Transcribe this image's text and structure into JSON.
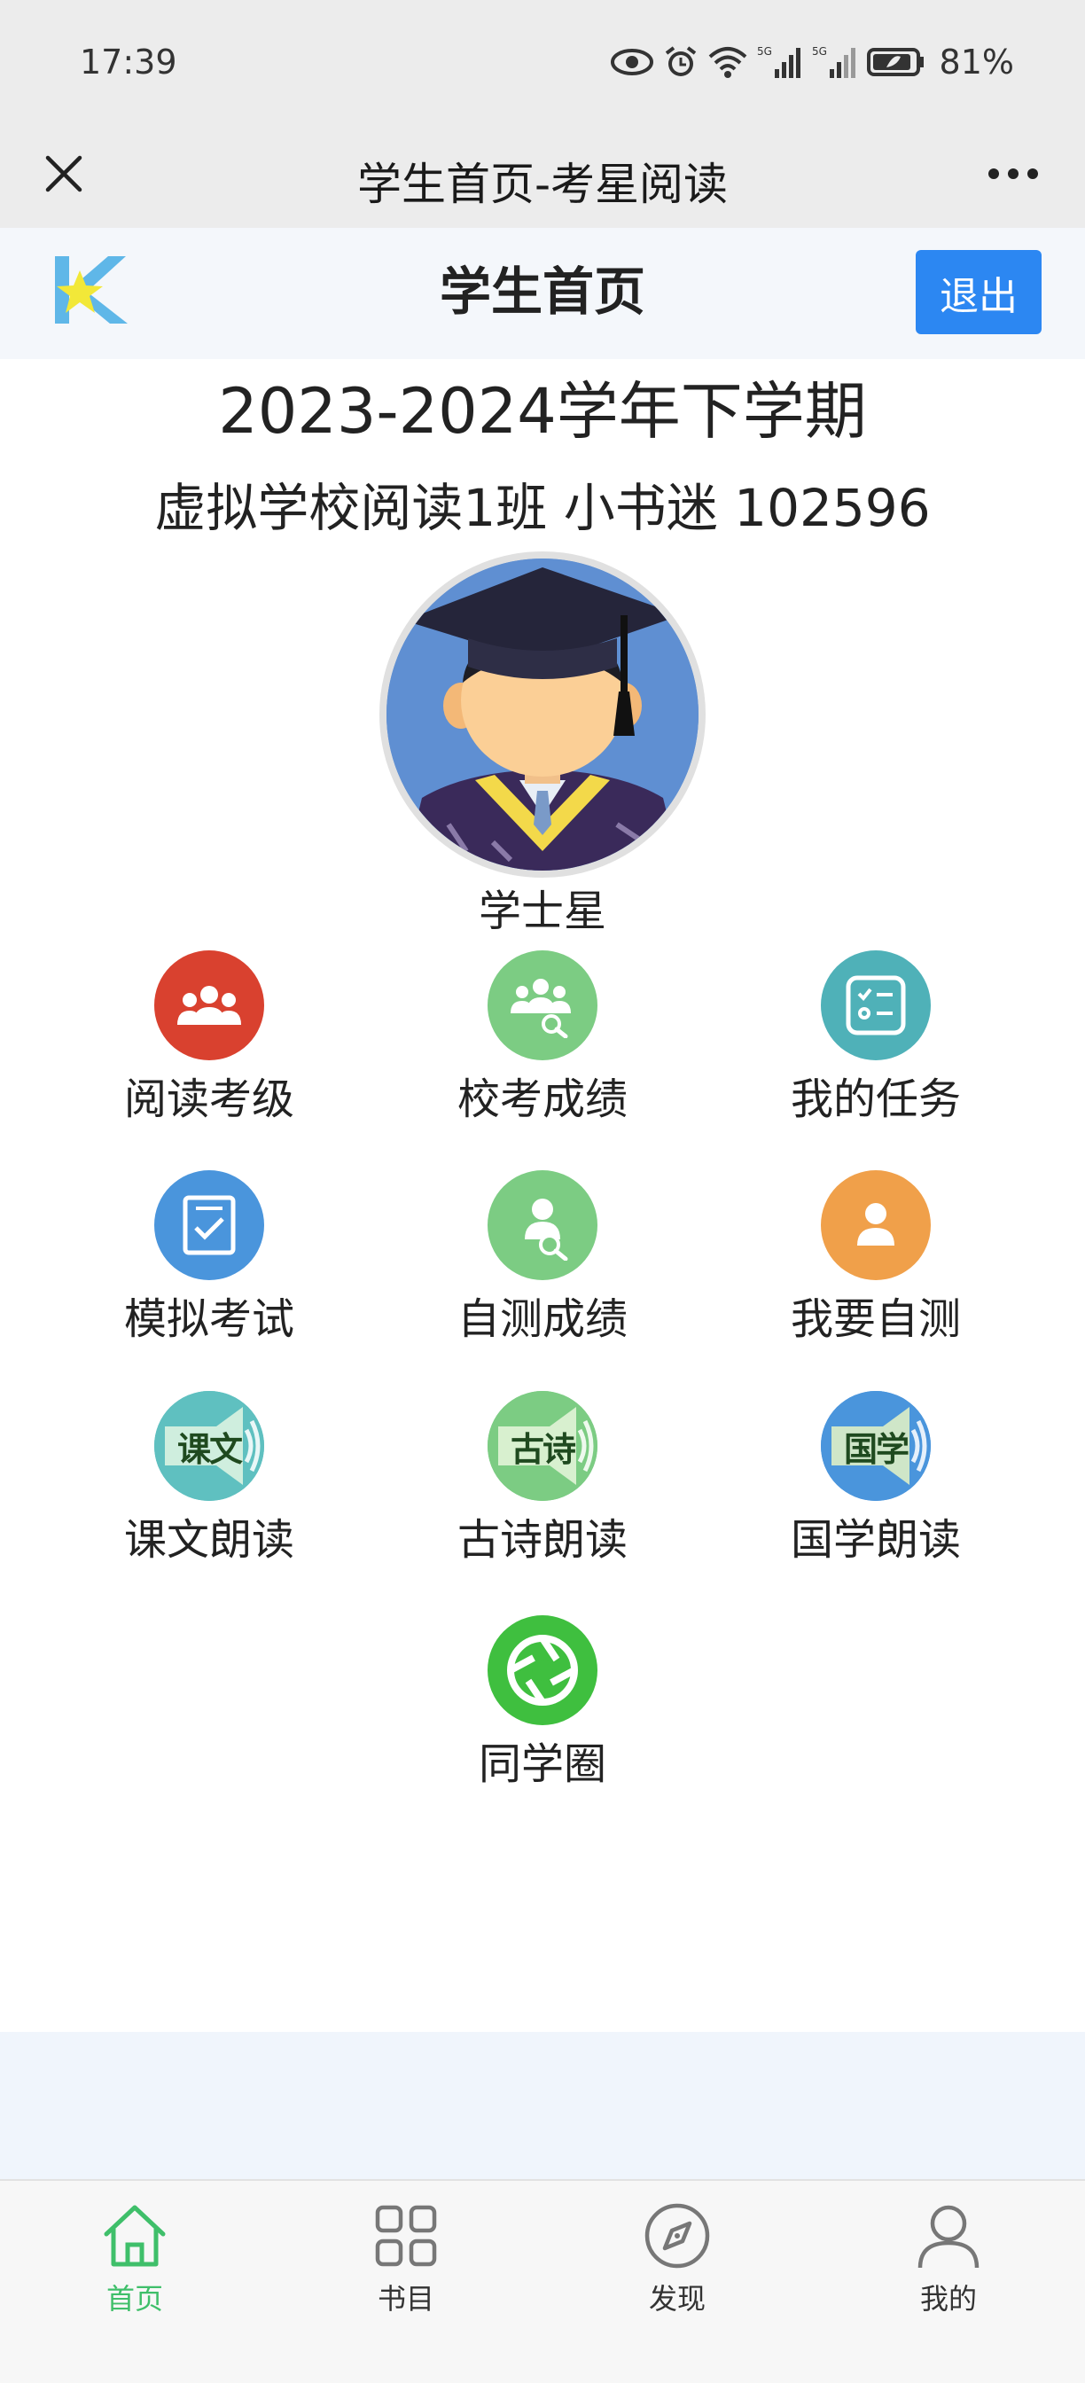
{
  "status_bar": {
    "time": "17:39",
    "battery": "81%"
  },
  "nav": {
    "title": "学生首页-考星阅读"
  },
  "header": {
    "title": "学生首页",
    "logout_label": "退出",
    "logo_letter": "K"
  },
  "student": {
    "term": "2023-2024学年下学期",
    "class_info": "虚拟学校阅读1班 小书迷 102596",
    "rank": "学士星"
  },
  "grid": [
    {
      "label": "阅读考级",
      "icon": "group-icon",
      "color": "#d9412f"
    },
    {
      "label": "校考成绩",
      "icon": "group-search-icon",
      "color": "#7ccc83"
    },
    {
      "label": "我的任务",
      "icon": "checklist-icon",
      "color": "#4fb1b8"
    },
    {
      "label": "模拟考试",
      "icon": "checkbox-doc-icon",
      "color": "#4a95dc"
    },
    {
      "label": "自测成绩",
      "icon": "person-search-icon",
      "color": "#7ccc83"
    },
    {
      "label": "我要自测",
      "icon": "person-icon",
      "color": "#f0a04a"
    },
    {
      "label": "课文朗读",
      "icon": "speaker-icon",
      "icon_text": "课文",
      "color": "#5fc0c0"
    },
    {
      "label": "古诗朗读",
      "icon": "speaker-icon",
      "icon_text": "古诗",
      "color": "#7ccc83"
    },
    {
      "label": "国学朗读",
      "icon": "speaker-icon",
      "icon_text": "国学",
      "color": "#4a95dc"
    },
    {
      "label": "同学圈",
      "icon": "aperture-icon",
      "color": "#3fbf3f"
    }
  ],
  "tabbar": [
    {
      "label": "首页",
      "icon": "home-icon",
      "active": true
    },
    {
      "label": "书目",
      "icon": "grid-icon",
      "active": false
    },
    {
      "label": "发现",
      "icon": "compass-icon",
      "active": false
    },
    {
      "label": "我的",
      "icon": "user-icon",
      "active": false
    }
  ],
  "colors": {
    "accent": "#2c87f2",
    "active_tab": "#3fbf6a"
  }
}
